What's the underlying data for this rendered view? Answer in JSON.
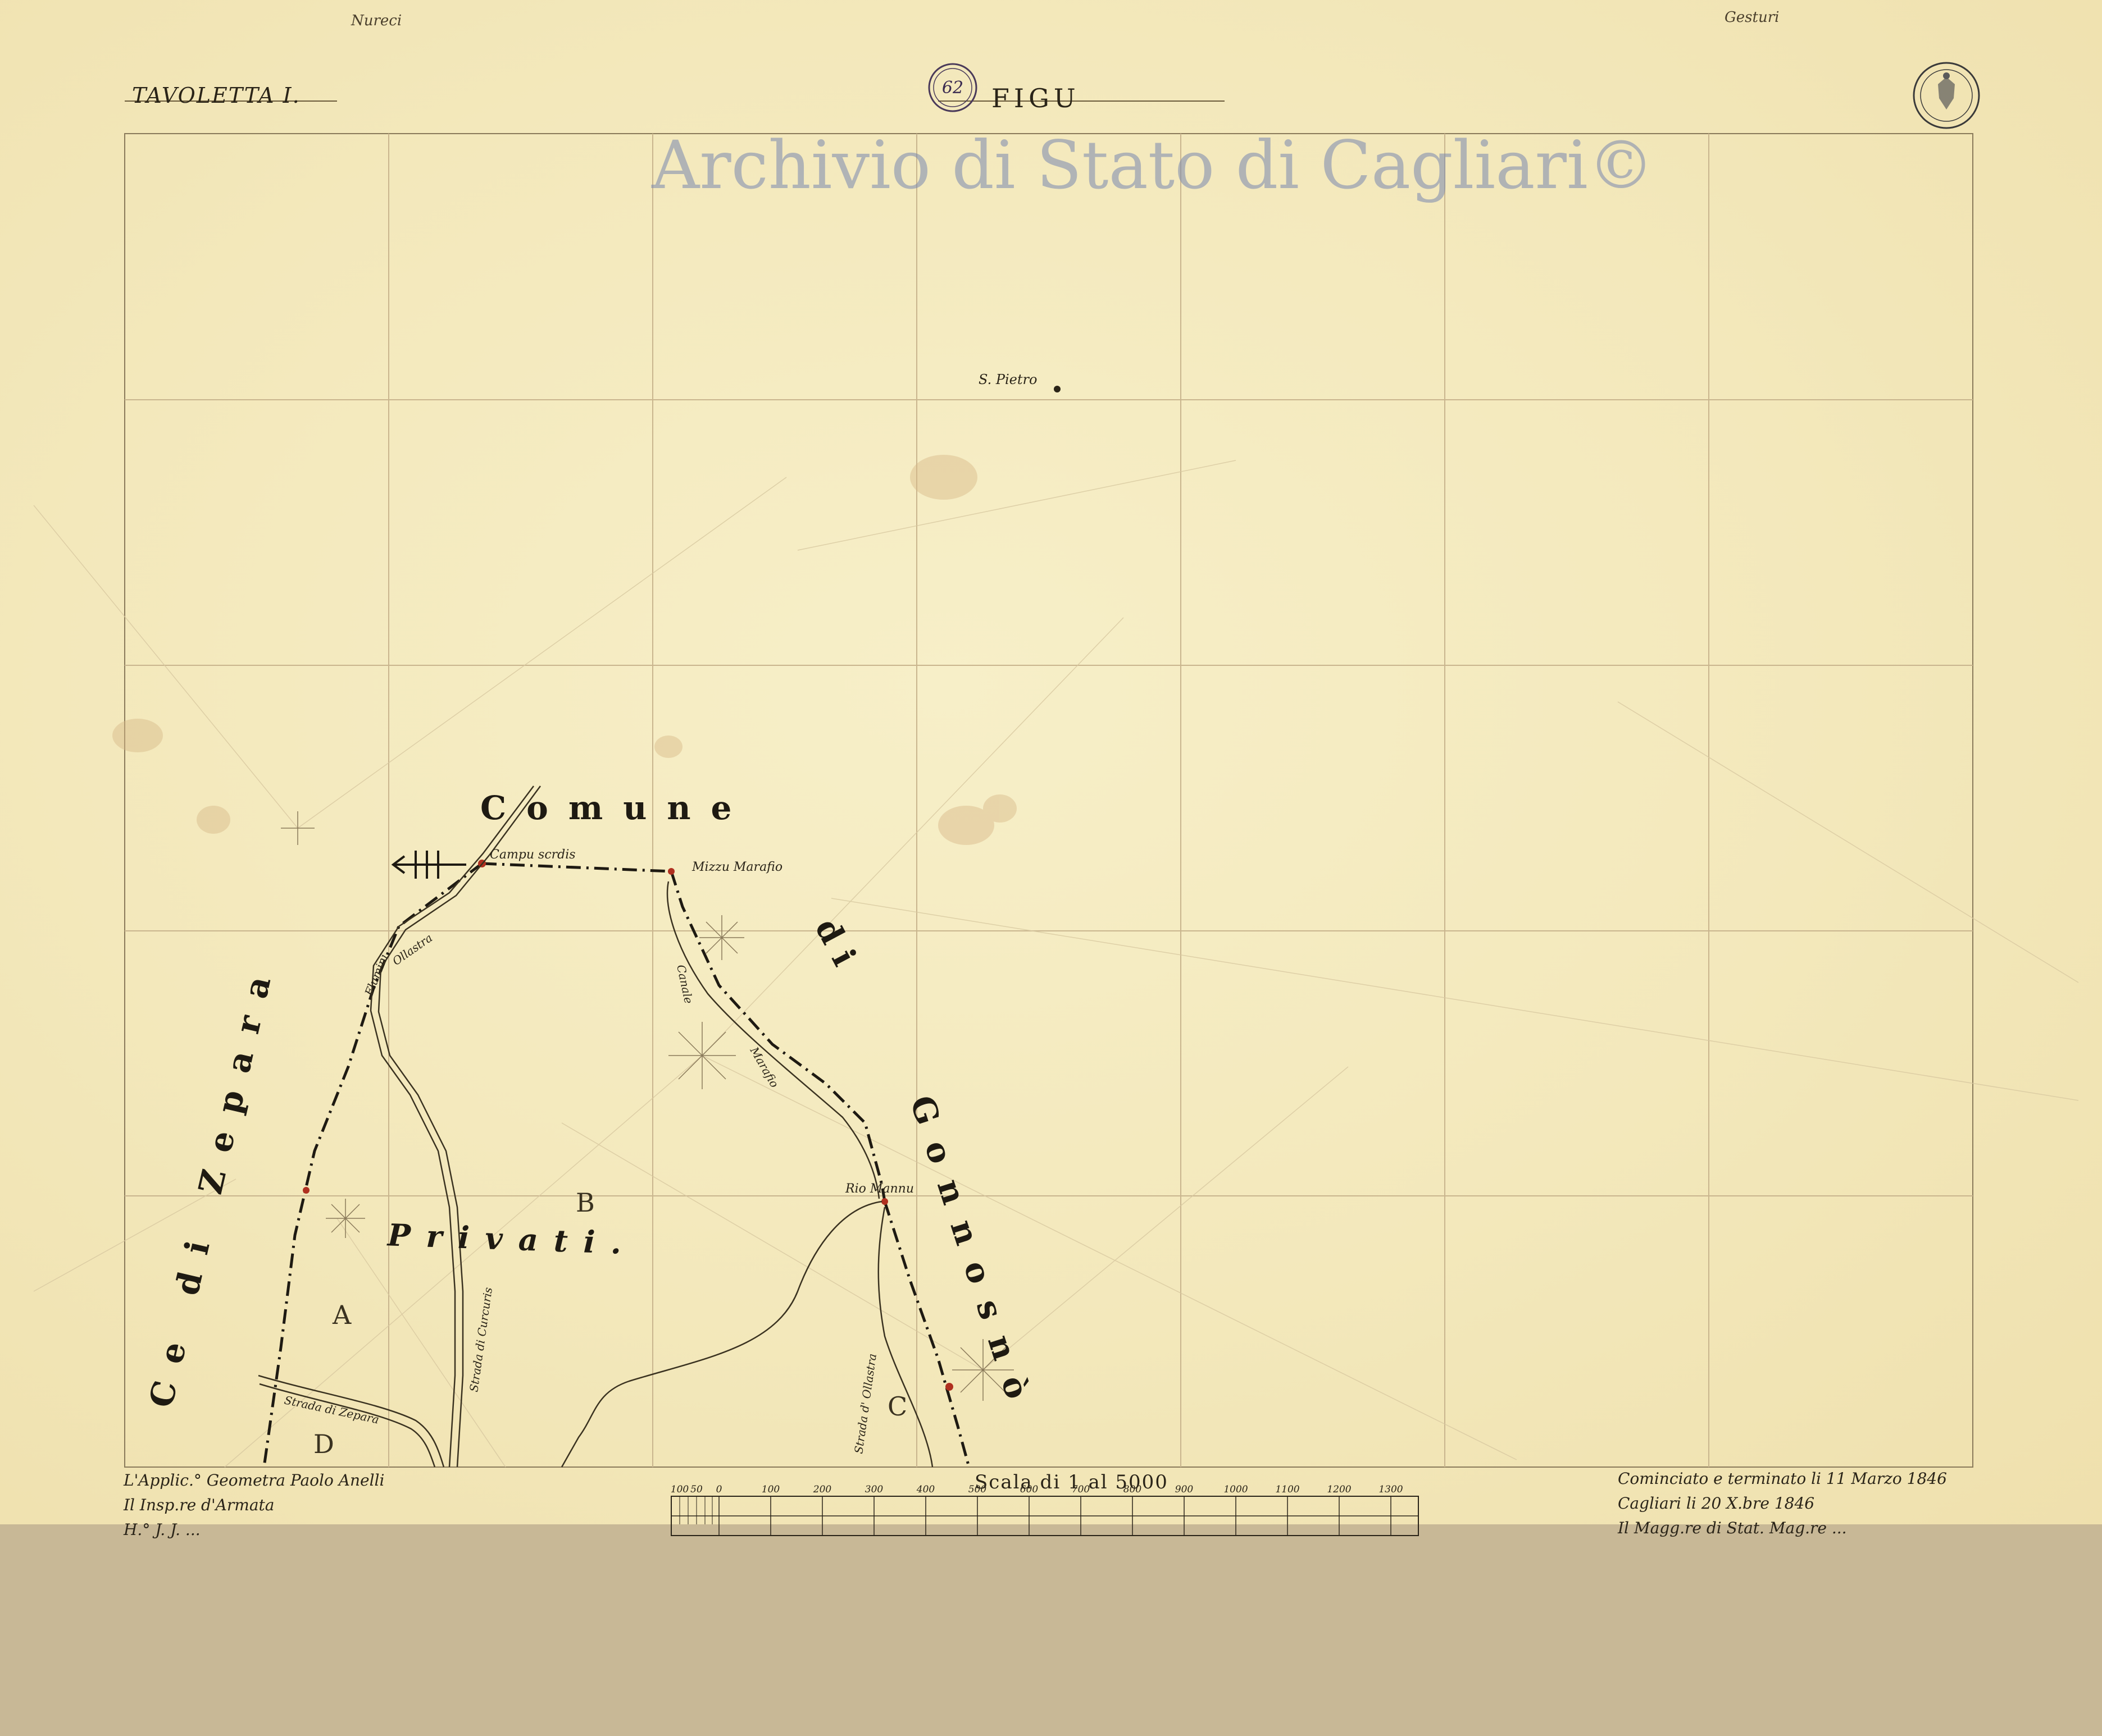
{
  "sheet": {
    "tavoletta_label": "TAVOLETTA I.",
    "title": "FIGU",
    "watermark": "Archivio di Stato di Cagliari©",
    "edge_top_left": "Nureci",
    "edge_top_right": "Gesturi"
  },
  "labels": {
    "comune": "Comune",
    "di": "di",
    "gonnosno": "Gonnosnò",
    "ce_di_zepara": "Ce di Zepara",
    "privati": "Privati.",
    "s_pietro": "S. Pietro",
    "campu_scrdis": "Campu scrdis",
    "mizzu_marafio": "Mizzu Marafio",
    "rio_mannu": "Rio Mannu",
    "strada_di_zepara": "Strada di Zepara",
    "strada_d_ollastra": "Strada d' Ollastra",
    "strada_di_curcuris": "Strada di Curcuris",
    "canale": "Canale",
    "flumini": "Flumini",
    "ollastra": "Ollastra",
    "marafio": "Marafio"
  },
  "parcels": [
    "A",
    "B",
    "C",
    "D"
  ],
  "scale": {
    "title": "Scala di 1 al 5000",
    "ticks": [
      "100",
      "50",
      "0",
      "100",
      "200",
      "300",
      "400",
      "500",
      "600",
      "700",
      "800",
      "900",
      "1000",
      "1100",
      "1200",
      "1300"
    ]
  },
  "notes": {
    "left": [
      "L'Applic.° Geometra Paolo Anelli",
      "Il Insp.re d'Armata",
      "H.° J. J. ..."
    ],
    "right": [
      "Cominciato e terminato li 11 Marzo 1846",
      "Cagliari li 20 X.bre 1846",
      "Il Magg.re di Stat. Mag.re ..."
    ]
  },
  "stamps": {
    "seal_number": "62"
  },
  "colors": {
    "paper": "#f3e8bb",
    "ink": "#2a2418",
    "watermark": "#7887af",
    "grid": "#c9b58e",
    "boundary": "#1e1a12",
    "red_accent": "#b03020",
    "band": "#c8b896"
  }
}
